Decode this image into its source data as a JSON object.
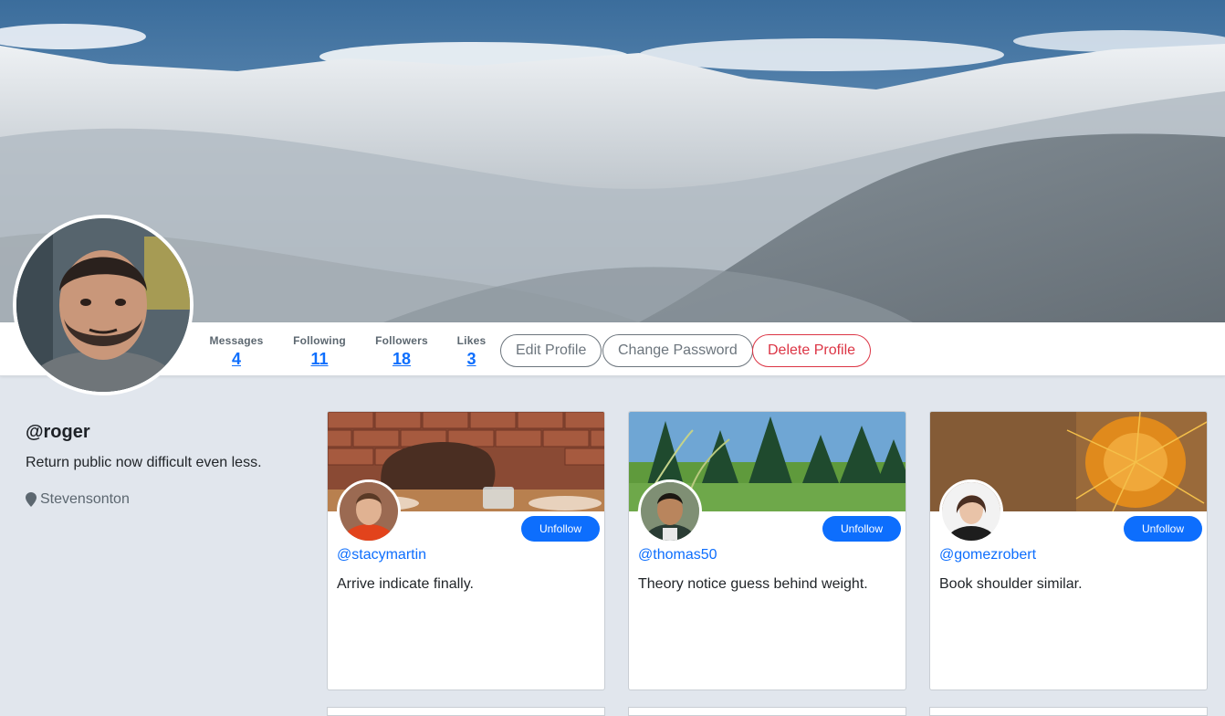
{
  "profile": {
    "username": "@roger",
    "bio": "Return public now difficult even less.",
    "location": "Stevensonton"
  },
  "stats": [
    {
      "label": "Messages",
      "value": "4"
    },
    {
      "label": "Following",
      "value": "11"
    },
    {
      "label": "Followers",
      "value": "18"
    },
    {
      "label": "Likes",
      "value": "3"
    }
  ],
  "actions": {
    "edit": "Edit Profile",
    "change_password": "Change Password",
    "delete": "Delete Profile"
  },
  "following": [
    {
      "handle": "@stacymartin",
      "bio": "Arrive indicate finally.",
      "button": "Unfollow",
      "cover": "brick wall and leather bag"
    },
    {
      "handle": "@thomas50",
      "bio": "Theory notice guess behind weight.",
      "button": "Unfollow",
      "cover": "pine forest meadow"
    },
    {
      "handle": "@gomezrobert",
      "bio": "Book shoulder similar.",
      "button": "Unfollow",
      "cover": "orange spiky plant"
    }
  ],
  "colors": {
    "primary": "#0d6efd",
    "danger": "#dc3545",
    "muted": "#6c757d",
    "page_bg": "#e1e6ed"
  }
}
